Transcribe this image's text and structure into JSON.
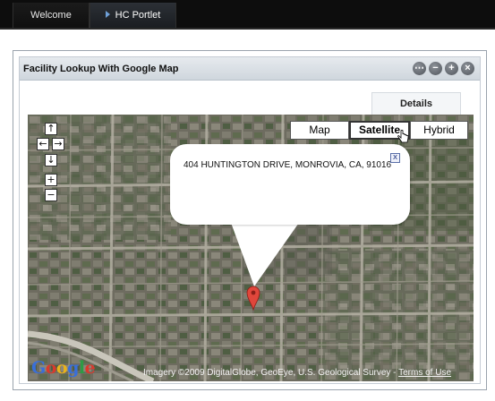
{
  "nav": {
    "tabs": [
      {
        "label": "Welcome"
      },
      {
        "label": "HC Portlet"
      }
    ]
  },
  "portlet": {
    "title": "Facility Lookup With Google Map",
    "controls": [
      "more",
      "minimize",
      "maximize",
      "close"
    ],
    "details_tab": "Details"
  },
  "map": {
    "nav_controls": {
      "up": "↑",
      "left": "←",
      "right": "→",
      "down": "↓",
      "zoom_in": "+",
      "zoom_out": "−"
    },
    "types": [
      {
        "label": "Map",
        "selected": false
      },
      {
        "label": "Satellite",
        "selected": true
      },
      {
        "label": "Hybrid",
        "selected": false
      }
    ],
    "info_window": {
      "address": "404 HUNTINGTON DRIVE, MONROVIA, CA, 91016",
      "close": "x"
    },
    "logo": {
      "letters": [
        "G",
        "o",
        "o",
        "g",
        "l",
        "e"
      ],
      "colors": [
        "#3a6fd9",
        "#d93a2e",
        "#e8b21d",
        "#3a6fd9",
        "#2e9b45",
        "#d93a2e"
      ]
    },
    "copyright": "Imagery ©2009 DigitalGlobe, GeoEye, U.S. Geological Survey - ",
    "terms": "Terms of Use",
    "marker_color": "#e0463b"
  }
}
